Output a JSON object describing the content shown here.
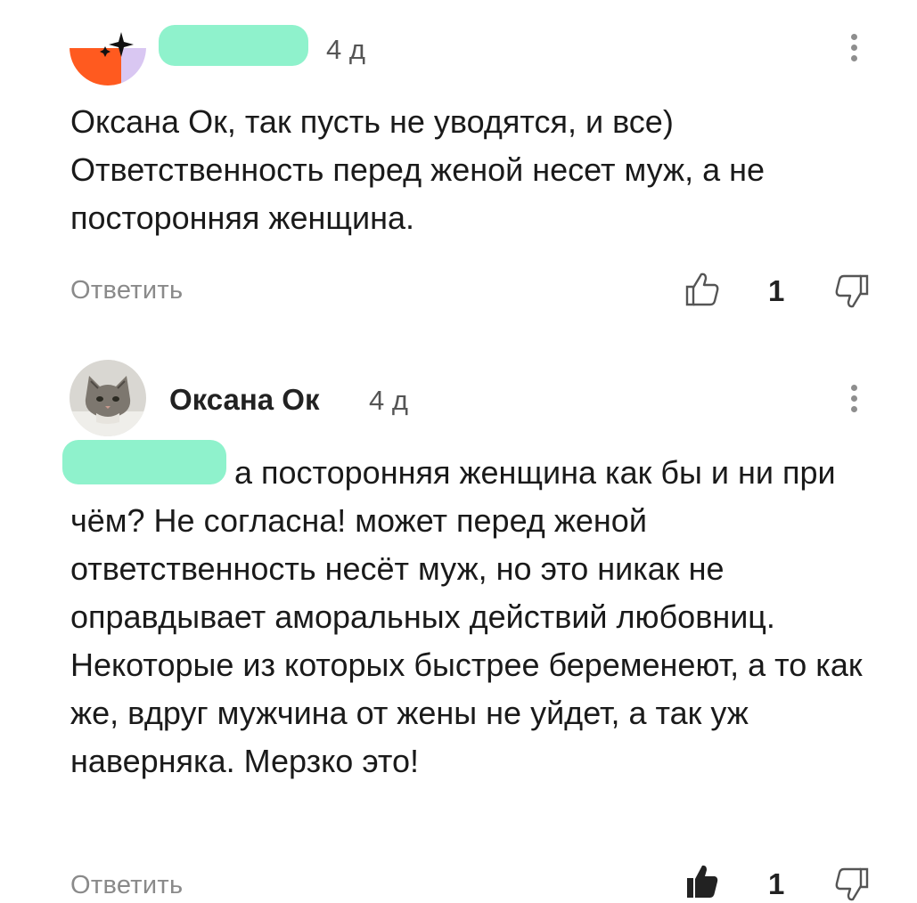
{
  "comments": [
    {
      "author": "",
      "time": "4 д",
      "text": "Оксана Ок, так пусть не уводятся, и все) Ответственность перед женой несет муж, а не посторонняя женщина.",
      "reply_label": "Ответить",
      "likes": "1",
      "liked": false
    },
    {
      "author": "Оксана Ок",
      "time": "4 д",
      "text": "а посторонняя женщина как бы и ни при чём? Не согласна! может перед женой ответственность несёт муж, но это никак не оправдывает аморальных действий любовниц. Некоторые из которых быстрее беременеют, а то как же, вдруг мужчина от жены не уйдет, а так уж наверняка. Мерзко это!",
      "reply_label": "Ответить",
      "likes": "1",
      "liked": true
    }
  ],
  "icons": {
    "like": "thumbs-up-icon",
    "dislike": "thumbs-down-icon",
    "menu": "more-vertical-icon"
  },
  "colors": {
    "redaction": "#8ff2cc",
    "avatar_orange": "#ff5a1f",
    "avatar_lavender": "#d9c7f2"
  }
}
